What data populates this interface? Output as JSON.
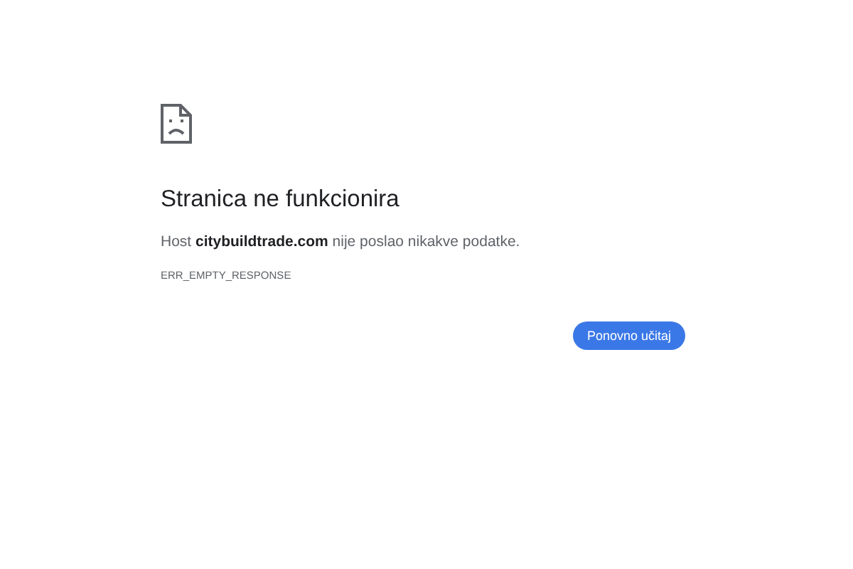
{
  "error": {
    "title": "Stranica ne funkcionira",
    "message": "Host **citybuildtrade.com** nije poslao nikakve podatke.",
    "code": "ERR_EMPTY_RESPONSE"
  },
  "buttons": [
    "Ponovno učitaj"
  ]
}
